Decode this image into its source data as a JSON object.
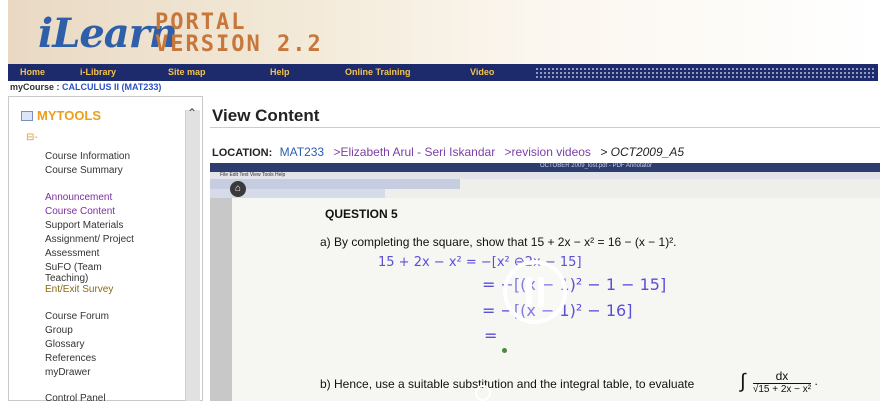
{
  "header": {
    "logo_text": "iLearn",
    "portal_line1": "PORTAL",
    "portal_line2": "VERSION 2.2"
  },
  "nav": {
    "items": [
      "Home",
      "i-Library",
      "Site map",
      "Help",
      "Online Training",
      "Video"
    ]
  },
  "course": {
    "label": "myCourse :",
    "name": "CALCULUS II (MAT233)"
  },
  "sidebar": {
    "title": "MYTOOLS",
    "root_symbol": "⊟-",
    "items": [
      "Course Information",
      "Course Summary",
      "Announcement",
      "Course Content",
      "Support Materials",
      "Assignment/ Project",
      "Assessment",
      "SuFO (Team Teaching)",
      "Ent/Exit Survey",
      "Course Forum",
      "Group",
      "Glossary",
      "References",
      "myDrawer",
      "Control Panel"
    ]
  },
  "main": {
    "title": "View Content",
    "location_label": "LOCATION:",
    "location_links": [
      "MAT233",
      ">Elizabeth Arul - Seri Iskandar",
      ">revision videos"
    ],
    "location_current": "> OCT2009_A5"
  },
  "video": {
    "window_title": "OCTOBER 2009_lost.pdf - PDF Annotator",
    "menu_text": "File  Edit  Text  View  Tools  Help",
    "question_title": "QUESTION 5",
    "part_a": "a)  By completing the square, show that  15 + 2x − x² = 16 − (x − 1)².",
    "part_b": "b)  Hence, use a suitable substitution and the integral table, to evaluate",
    "integral_sign": "∫",
    "integral_num": "dx",
    "integral_den": "√15 + 2x − x²",
    "handwriting": [
      "15 + 2x − x² = −[x² ⊖2x − 15]",
      "= −[(x − 1)² − 1 − 15]",
      "= −[(x − 1)² − 16]",
      "="
    ]
  },
  "colors": {
    "nav_bg": "#1d2a6b",
    "nav_text": "#f3c44a",
    "mytools": "#e8a01e",
    "link_purple": "#7c2f9e",
    "link_blue": "#2c5fb0",
    "handwriting": "#5a4fd8"
  }
}
